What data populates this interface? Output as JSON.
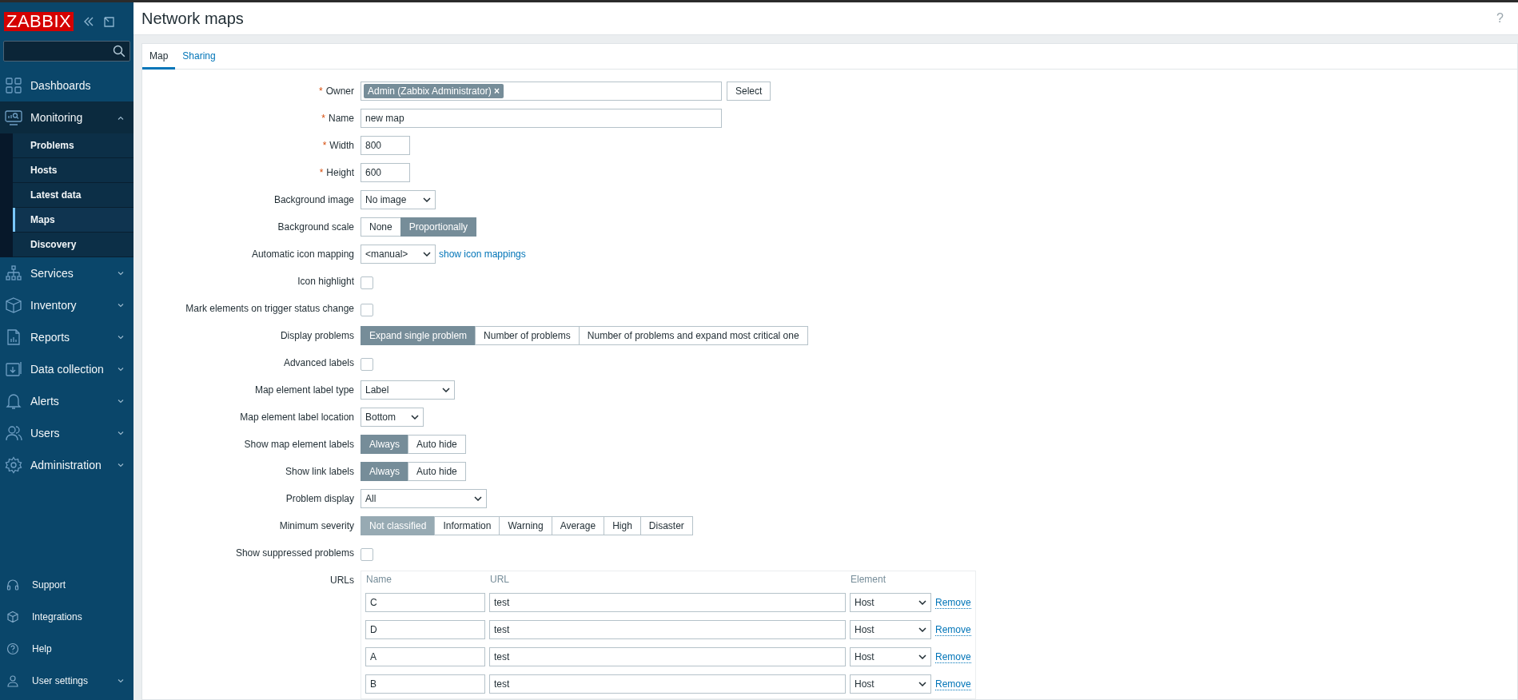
{
  "sidebar": {
    "logo": "ZABBIX",
    "items": [
      {
        "label": "Dashboards",
        "expanded": false,
        "has_children": false
      },
      {
        "label": "Monitoring",
        "expanded": true,
        "has_children": true,
        "children": [
          {
            "label": "Problems",
            "selected": false
          },
          {
            "label": "Hosts",
            "selected": false
          },
          {
            "label": "Latest data",
            "selected": false
          },
          {
            "label": "Maps",
            "selected": true
          },
          {
            "label": "Discovery",
            "selected": false
          }
        ]
      },
      {
        "label": "Services",
        "expanded": false,
        "has_children": true
      },
      {
        "label": "Inventory",
        "expanded": false,
        "has_children": true
      },
      {
        "label": "Reports",
        "expanded": false,
        "has_children": true
      },
      {
        "label": "Data collection",
        "expanded": false,
        "has_children": true
      },
      {
        "label": "Alerts",
        "expanded": false,
        "has_children": true
      },
      {
        "label": "Users",
        "expanded": false,
        "has_children": true
      },
      {
        "label": "Administration",
        "expanded": false,
        "has_children": true
      }
    ],
    "bottom_items": [
      {
        "label": "Support",
        "has_children": false
      },
      {
        "label": "Integrations",
        "has_children": false
      },
      {
        "label": "Help",
        "has_children": false
      },
      {
        "label": "User settings",
        "has_children": true
      }
    ]
  },
  "header": {
    "title": "Network maps",
    "help": "?"
  },
  "tabs": [
    {
      "label": "Map",
      "selected": true
    },
    {
      "label": "Sharing",
      "selected": false
    }
  ],
  "form": {
    "rows": [
      {
        "kind": "multiselect",
        "label": "Owner",
        "required_mark": "*",
        "tags": [
          "Admin (Zabbix Administrator)"
        ],
        "tag_remove": "×",
        "button": "Select"
      },
      {
        "kind": "text",
        "label": "Name",
        "required_mark": "*",
        "value": "new map"
      },
      {
        "kind": "number",
        "label": "Width",
        "required_mark": "*",
        "value": "800"
      },
      {
        "kind": "number",
        "label": "Height",
        "required_mark": "*",
        "value": "600"
      },
      {
        "kind": "select",
        "label": "Background image",
        "value": "No image"
      },
      {
        "kind": "segmented",
        "label": "Background scale",
        "options": [
          {
            "label": "None",
            "selected": false
          },
          {
            "label": "Proportionally",
            "selected": true
          }
        ]
      },
      {
        "kind": "select",
        "label": "Automatic icon mapping",
        "value": "<manual>",
        "link": "show icon mappings"
      },
      {
        "kind": "checkbox",
        "label": "Icon highlight",
        "checked": false
      },
      {
        "kind": "checkbox",
        "label": "Mark elements on trigger status change",
        "checked": false
      },
      {
        "kind": "segmented",
        "label": "Display problems",
        "options": [
          {
            "label": "Expand single problem",
            "selected": true
          },
          {
            "label": "Number of problems",
            "selected": false
          },
          {
            "label": "Number of problems and expand most critical one",
            "selected": false
          }
        ]
      },
      {
        "kind": "checkbox",
        "label": "Advanced labels",
        "checked": false
      },
      {
        "kind": "select",
        "label": "Map element label type",
        "value": "Label"
      },
      {
        "kind": "select",
        "label": "Map element label location",
        "value": "Bottom"
      },
      {
        "kind": "segmented",
        "label": "Show map element labels",
        "options": [
          {
            "label": "Always",
            "selected": true
          },
          {
            "label": "Auto hide",
            "selected": false
          }
        ]
      },
      {
        "kind": "segmented",
        "label": "Show link labels",
        "options": [
          {
            "label": "Always",
            "selected": true
          },
          {
            "label": "Auto hide",
            "selected": false
          }
        ]
      },
      {
        "kind": "select",
        "label": "Problem display",
        "value": "All"
      },
      {
        "kind": "segmented",
        "label": "Minimum severity",
        "options": [
          {
            "label": "Not classified",
            "selected": true
          },
          {
            "label": "Information",
            "selected": false
          },
          {
            "label": "Warning",
            "selected": false
          },
          {
            "label": "Average",
            "selected": false
          },
          {
            "label": "High",
            "selected": false
          },
          {
            "label": "Disaster",
            "selected": false
          }
        ]
      },
      {
        "kind": "checkbox",
        "label": "Show suppressed problems",
        "checked": false
      },
      {
        "kind": "urls",
        "label": "URLs",
        "columns": [
          "Name",
          "URL",
          "Element"
        ],
        "items": [
          {
            "name": "C",
            "url": "test",
            "element": "Host",
            "action": "Remove"
          },
          {
            "name": "D",
            "url": "test",
            "element": "Host",
            "action": "Remove"
          },
          {
            "name": "A",
            "url": "test",
            "element": "Host",
            "action": "Remove"
          },
          {
            "name": "B",
            "url": "test",
            "element": "Host",
            "action": "Remove"
          }
        ]
      }
    ]
  }
}
